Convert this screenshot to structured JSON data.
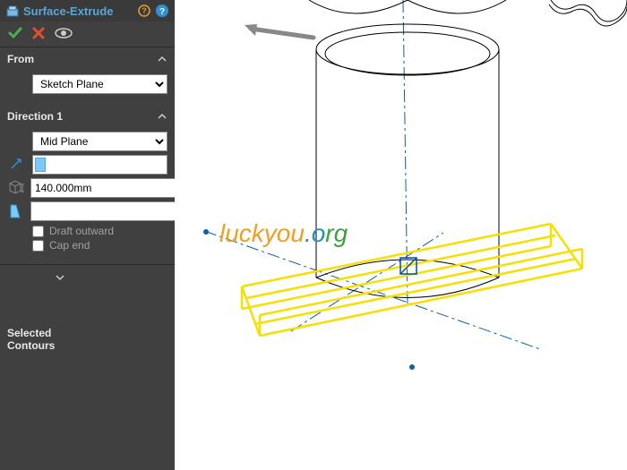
{
  "title": "Surface-Extrude",
  "from": {
    "label": "From",
    "options": [
      "Sketch Plane"
    ],
    "selected": "Sketch Plane"
  },
  "direction1": {
    "label": "Direction 1",
    "end_condition": "Mid Plane",
    "end_options": [
      "Mid Plane"
    ],
    "depth": "140.000mm",
    "draft_outward": {
      "label": "Draft outward",
      "checked": false
    },
    "cap_end": {
      "label": "Cap end",
      "checked": false
    }
  },
  "selected_contours": {
    "label": "Selected Contours"
  },
  "watermark": {
    "p1": "luckyou",
    "p2": ".o",
    "p3": "rg"
  }
}
